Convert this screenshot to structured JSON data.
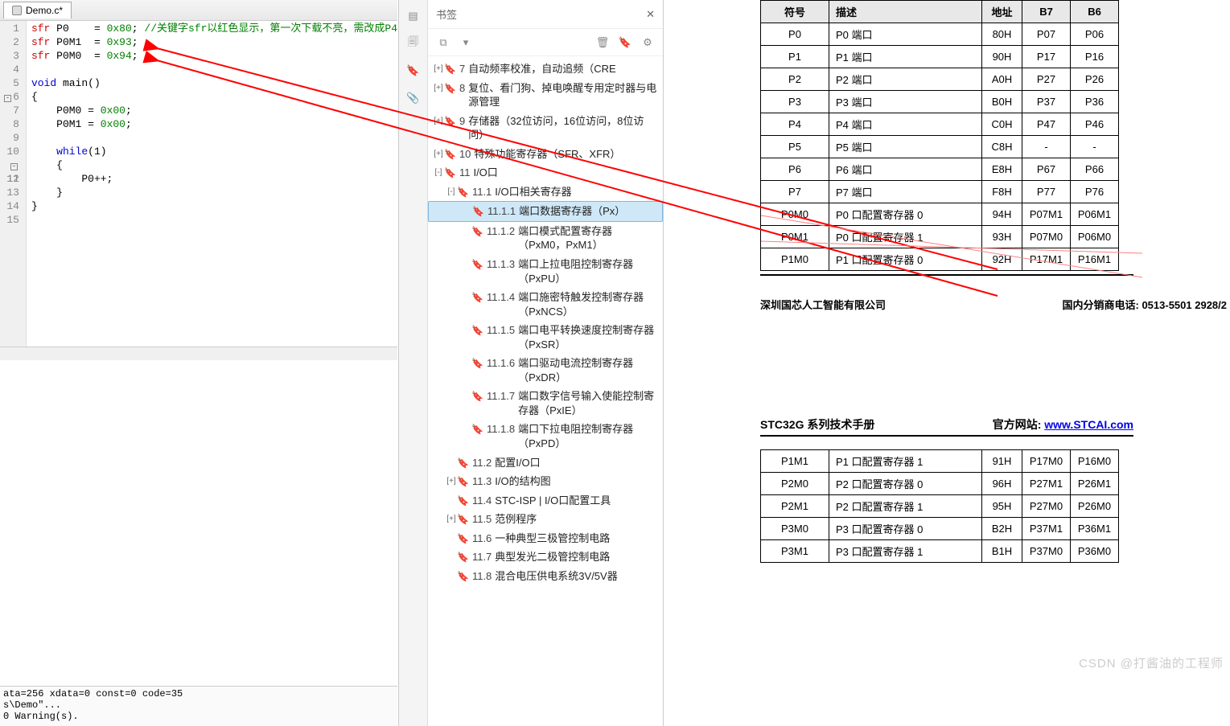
{
  "editor": {
    "tab_filename": "Demo.c*",
    "lines": [
      {
        "n": "1",
        "fold": "",
        "html": "<span class='kw-sfr'>sfr</span> P0    = <span class='num'>0x80</span>; <span class='comment'>//关键字sfr以红色显示，第一次下载不亮，需改成P4</span>"
      },
      {
        "n": "2",
        "fold": "",
        "html": "<span class='kw-sfr'>sfr</span> P0M1  = <span class='num'>0x93</span>;"
      },
      {
        "n": "3",
        "fold": "",
        "html": "<span class='kw-sfr'>sfr</span> P0M0  = <span class='num'>0x94</span>;"
      },
      {
        "n": "4",
        "fold": "",
        "html": ""
      },
      {
        "n": "5",
        "fold": "",
        "html": "<span class='kw-blue'>void</span> main()"
      },
      {
        "n": "6",
        "fold": "-",
        "html": "{"
      },
      {
        "n": "7",
        "fold": "",
        "html": "    P0M0 = <span class='num'>0x00</span>;"
      },
      {
        "n": "8",
        "fold": "",
        "html": "    P0M1 = <span class='num'>0x00</span>;"
      },
      {
        "n": "9",
        "fold": "",
        "html": ""
      },
      {
        "n": "10",
        "fold": "",
        "html": "    <span class='kw-blue'>while</span>(1)"
      },
      {
        "n": "11",
        "fold": "-",
        "html": "    {"
      },
      {
        "n": "12",
        "fold": "",
        "html": "        P0++;"
      },
      {
        "n": "13",
        "fold": "",
        "html": "    }"
      },
      {
        "n": "14",
        "fold": "",
        "html": "}"
      },
      {
        "n": "15",
        "fold": "",
        "html": ""
      }
    ],
    "status1": "ata=256 xdata=0 const=0 code=35",
    "status2": "s\\Demo\"...",
    "status3": "0 Warning(s)."
  },
  "bookmark": {
    "title": "书签",
    "toc": [
      {
        "depth": 0,
        "tw": "+",
        "num": "7",
        "label": "自动频率校准，自动追频（CRE"
      },
      {
        "depth": 0,
        "tw": "+",
        "num": "8",
        "label": "复位、看门狗、掉电唤醒专用定时器与电源管理"
      },
      {
        "depth": 0,
        "tw": "+",
        "num": "9",
        "label": "存储器（32位访问，16位访问，8位访问）"
      },
      {
        "depth": 0,
        "tw": "+",
        "num": "10",
        "label": "特殊功能寄存器（SFR、XFR）"
      },
      {
        "depth": 0,
        "tw": "-",
        "num": "11",
        "label": "I/O口"
      },
      {
        "depth": 1,
        "tw": "-",
        "num": "11.1",
        "label": "I/O口相关寄存器"
      },
      {
        "depth": 2,
        "tw": "",
        "num": "11.1.1",
        "label": "端口数据寄存器（Px）",
        "selected": true
      },
      {
        "depth": 2,
        "tw": "",
        "num": "11.1.2",
        "label": "端口模式配置寄存器（PxM0，PxM1）"
      },
      {
        "depth": 2,
        "tw": "",
        "num": "11.1.3",
        "label": "端口上拉电阻控制寄存器（PxPU）"
      },
      {
        "depth": 2,
        "tw": "",
        "num": "11.1.4",
        "label": "端口施密特触发控制寄存器（PxNCS）"
      },
      {
        "depth": 2,
        "tw": "",
        "num": "11.1.5",
        "label": "端口电平转换速度控制寄存器（PxSR）"
      },
      {
        "depth": 2,
        "tw": "",
        "num": "11.1.6",
        "label": "端口驱动电流控制寄存器（PxDR）"
      },
      {
        "depth": 2,
        "tw": "",
        "num": "11.1.7",
        "label": "端口数字信号输入使能控制寄存器（PxIE）"
      },
      {
        "depth": 2,
        "tw": "",
        "num": "11.1.8",
        "label": "端口下拉电阻控制寄存器（PxPD）"
      },
      {
        "depth": 1,
        "tw": "",
        "num": "11.2",
        "label": "配置I/O口"
      },
      {
        "depth": 1,
        "tw": "+",
        "num": "11.3",
        "label": "I/O的结构图"
      },
      {
        "depth": 1,
        "tw": "",
        "num": "11.4",
        "label": "STC-ISP | I/O口配置工具"
      },
      {
        "depth": 1,
        "tw": "+",
        "num": "11.5",
        "label": "范例程序"
      },
      {
        "depth": 1,
        "tw": "",
        "num": "11.6",
        "label": "一种典型三极管控制电路"
      },
      {
        "depth": 1,
        "tw": "",
        "num": "11.7",
        "label": "典型发光二极管控制电路"
      },
      {
        "depth": 1,
        "tw": "",
        "num": "11.8",
        "label": "混合电压供电系统3V/5V器"
      }
    ]
  },
  "table1": {
    "headers": {
      "sym": "符号",
      "desc": "描述",
      "addr": "地址",
      "b7": "B7",
      "b6": "B6"
    },
    "rows": [
      {
        "sym": "P0",
        "desc": "P0 端口",
        "addr": "80H",
        "b7": "P07",
        "b6": "P06"
      },
      {
        "sym": "P1",
        "desc": "P1 端口",
        "addr": "90H",
        "b7": "P17",
        "b6": "P16"
      },
      {
        "sym": "P2",
        "desc": "P2 端口",
        "addr": "A0H",
        "b7": "P27",
        "b6": "P26"
      },
      {
        "sym": "P3",
        "desc": "P3 端口",
        "addr": "B0H",
        "b7": "P37",
        "b6": "P36"
      },
      {
        "sym": "P4",
        "desc": "P4 端口",
        "addr": "C0H",
        "b7": "P47",
        "b6": "P46"
      },
      {
        "sym": "P5",
        "desc": "P5 端口",
        "addr": "C8H",
        "b7": "-",
        "b6": "-"
      },
      {
        "sym": "P6",
        "desc": "P6 端口",
        "addr": "E8H",
        "b7": "P67",
        "b6": "P66"
      },
      {
        "sym": "P7",
        "desc": "P7 端口",
        "addr": "F8H",
        "b7": "P77",
        "b6": "P76"
      },
      {
        "sym": "P0M0",
        "desc": "P0 口配置寄存器 0",
        "addr": "94H",
        "b7": "P07M1",
        "b6": "P06M1"
      },
      {
        "sym": "P0M1",
        "desc": "P0 口配置寄存器 1",
        "addr": "93H",
        "b7": "P07M0",
        "b6": "P06M0"
      },
      {
        "sym": "P1M0",
        "desc": "P1 口配置寄存器 0",
        "addr": "92H",
        "b7": "P17M1",
        "b6": "P16M1"
      }
    ]
  },
  "footer1": {
    "left": "深圳国芯人工智能有限公司",
    "right": "国内分销商电话: 0513-5501 2928/2"
  },
  "header2": {
    "left": "STC32G 系列技术手册",
    "right_label": "官方网站: ",
    "right_link": "www.STCAI.com"
  },
  "table2": {
    "rows": [
      {
        "sym": "P1M1",
        "desc": "P1 口配置寄存器 1",
        "addr": "91H",
        "b7": "P17M0",
        "b6": "P16M0"
      },
      {
        "sym": "P2M0",
        "desc": "P2 口配置寄存器 0",
        "addr": "96H",
        "b7": "P27M1",
        "b6": "P26M1"
      },
      {
        "sym": "P2M1",
        "desc": "P2 口配置寄存器 1",
        "addr": "95H",
        "b7": "P27M0",
        "b6": "P26M0"
      },
      {
        "sym": "P3M0",
        "desc": "P3 口配置寄存器 0",
        "addr": "B2H",
        "b7": "P37M1",
        "b6": "P36M1"
      },
      {
        "sym": "P3M1",
        "desc": "P3 口配置寄存器 1",
        "addr": "B1H",
        "b7": "P37M0",
        "b6": "P36M0"
      }
    ]
  },
  "watermark": "CSDN @打酱油的工程师"
}
